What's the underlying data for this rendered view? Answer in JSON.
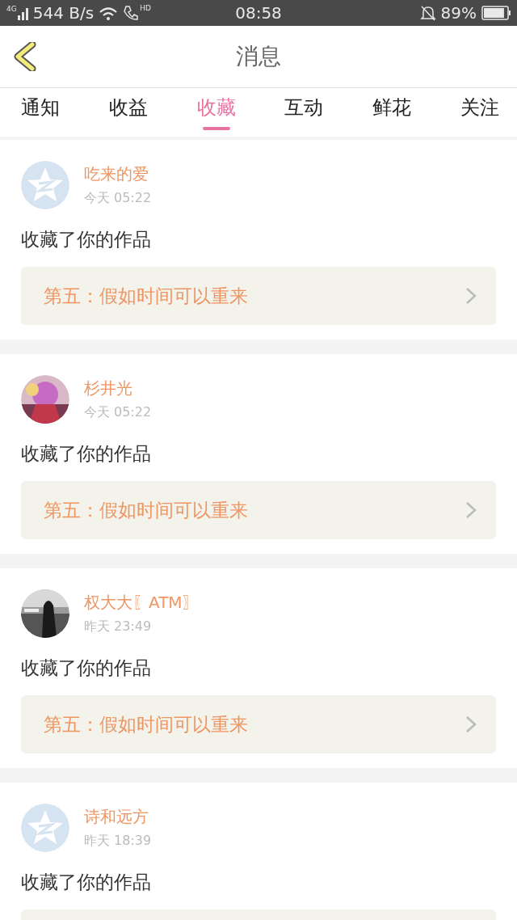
{
  "status_bar": {
    "network": "4G",
    "speed": "544 B/s",
    "call_badge": "HD",
    "time": "08:58",
    "battery": "89%"
  },
  "header": {
    "title": "消息"
  },
  "tabs": [
    {
      "label": "通知",
      "selected": false
    },
    {
      "label": "收益",
      "selected": false
    },
    {
      "label": "收藏",
      "selected": true
    },
    {
      "label": "互动",
      "selected": false
    },
    {
      "label": "鲜花",
      "selected": false
    },
    {
      "label": "关注",
      "selected": false
    }
  ],
  "messages": [
    {
      "avatar": {
        "kind": "default"
      },
      "name": "吃来的爱",
      "time": "今天 05:22",
      "text": "收藏了你的作品",
      "work": {
        "title": "第五：假如时间可以重来"
      }
    },
    {
      "name": "杉井光",
      "time": "今天 05:22",
      "text": "收藏了你的作品",
      "work": {
        "title": "第五：假如时间可以重来"
      }
    },
    {
      "name": "权大大〖ATM〗",
      "time": "昨天 23:49",
      "text": "收藏了你的作品",
      "work": {
        "title": "第五：假如时间可以重来"
      }
    },
    {
      "avatar": {
        "kind": "default"
      },
      "name": "诗和远方",
      "time": "昨天 18:39",
      "text": "收藏了你的作品",
      "work_box": true
    }
  ]
}
